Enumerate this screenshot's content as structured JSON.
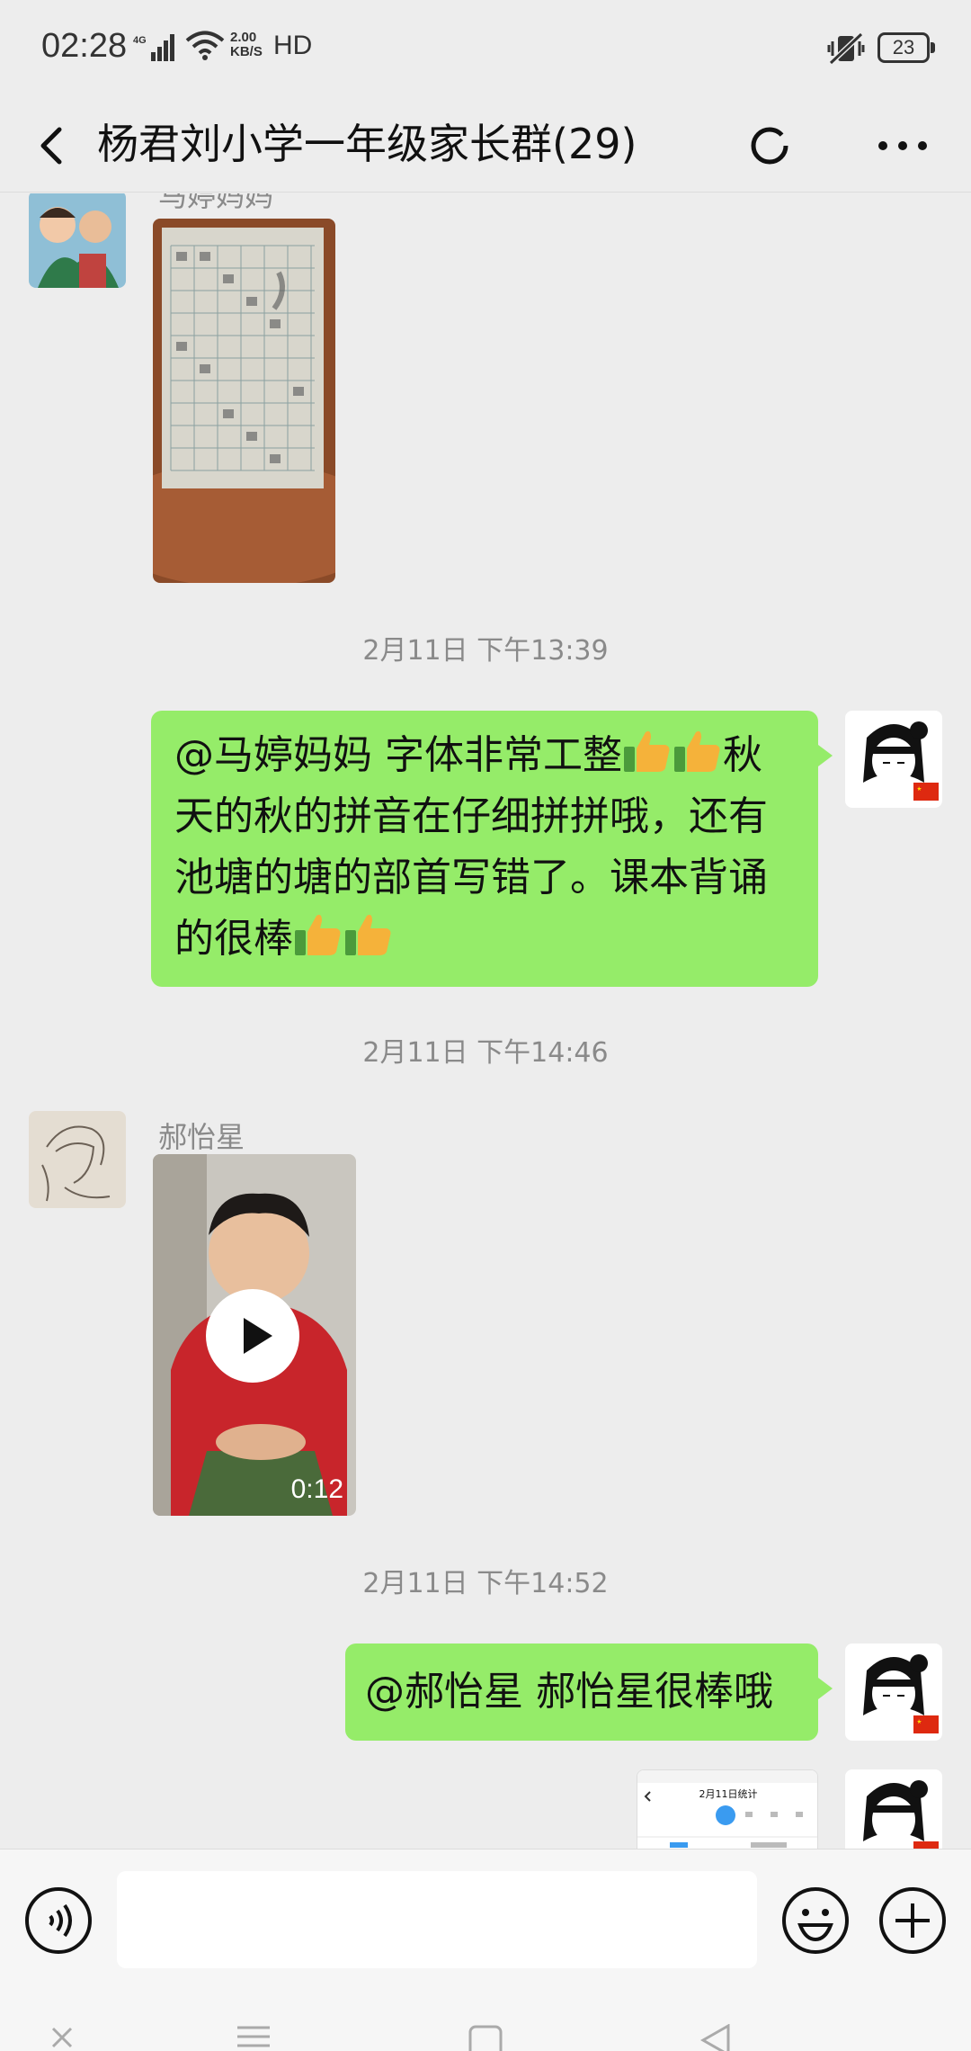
{
  "status_bar": {
    "time": "02:28",
    "network_type": "4G",
    "net_speed_value": "2.00",
    "net_speed_unit": "KB/S",
    "hd": "HD",
    "battery": "23"
  },
  "header": {
    "title": "杨君刘小学一年级家长群(29)",
    "back_icon": "chevron-left-icon",
    "refresh_icon": "circle-icon",
    "more_icon": "more-dots-icon"
  },
  "messages": [
    {
      "type": "image",
      "side": "left",
      "sender": "马婷妈妈",
      "content": "homework-photo"
    },
    {
      "type": "timestamp",
      "text": "2月11日 下午13:39"
    },
    {
      "type": "text",
      "side": "right",
      "lines": [
        "@马婷妈妈  字体非常工整",
        "秋",
        "天的秋的拼音在仔细拼拼哦，还有",
        "池塘的塘的部首写错了。课本背诵",
        "的很棒"
      ]
    },
    {
      "type": "timestamp",
      "text": "2月11日 下午14:46"
    },
    {
      "type": "video",
      "side": "left",
      "sender": "郝怡星",
      "duration": "0:12"
    },
    {
      "type": "timestamp",
      "text": "2月11日 下午14:52"
    },
    {
      "type": "text",
      "side": "right",
      "text": "@郝怡星  郝怡星很棒哦"
    },
    {
      "type": "image",
      "side": "right",
      "content": "screenshot-thumbnail",
      "preview_title": "2月11日统计"
    }
  ],
  "input_bar": {
    "placeholder": "",
    "voice_icon": "voice-icon",
    "emoji_icon": "smiley-icon",
    "plus_icon": "plus-icon"
  },
  "colors": {
    "background": "#ededed",
    "bubble_self": "#95ec69",
    "timestamp": "#8a8a8a"
  }
}
